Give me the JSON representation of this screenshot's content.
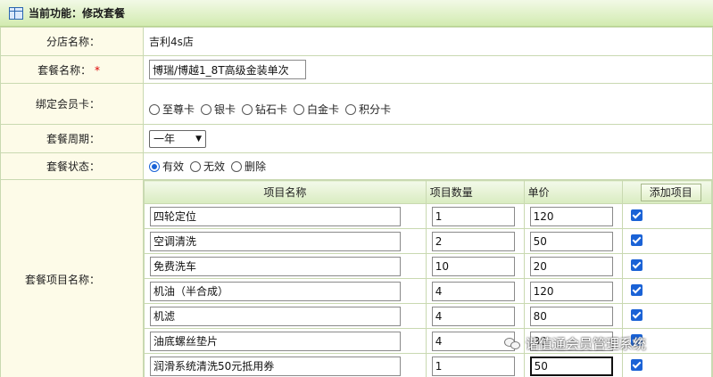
{
  "header": {
    "title": "当前功能：修改套餐",
    "icon": "table-icon"
  },
  "store": {
    "label": "分店名称：",
    "value": "吉利4s店"
  },
  "package_name": {
    "label": "套餐名称：",
    "required": "*",
    "value": "博瑞/博越1_8T高级金装单次"
  },
  "member_card": {
    "label": "绑定会员卡：",
    "options": [
      "至尊卡",
      "银卡",
      "钻石卡",
      "白金卡",
      "积分卡"
    ]
  },
  "period": {
    "label": "套餐周期：",
    "value": "一年"
  },
  "status": {
    "label": "套餐状态：",
    "options": [
      "有效",
      "无效",
      "删除"
    ],
    "selected": "有效"
  },
  "items": {
    "label": "套餐项目名称：",
    "headers": [
      "项目名称",
      "项目数量",
      "单价"
    ],
    "add_button": "添加项目",
    "rows": [
      {
        "name": "四轮定位",
        "qty": "1",
        "price": "120"
      },
      {
        "name": "空调清洗",
        "qty": "2",
        "price": "50"
      },
      {
        "name": "免费洗车",
        "qty": "10",
        "price": "20"
      },
      {
        "name": "机油（半合成）",
        "qty": "4",
        "price": "120"
      },
      {
        "name": "机滤",
        "qty": "4",
        "price": "80"
      },
      {
        "name": "油底螺丝垫片",
        "qty": "4",
        "price": "30"
      },
      {
        "name": "润滑系统清洗50元抵用券",
        "qty": "1",
        "price": "50"
      }
    ]
  },
  "watermark": {
    "text": "谐值通会员管理系统"
  },
  "colors": {
    "header_bg": "#d2ebb0",
    "label_bg": "#fdfbe8",
    "border": "#c9d9b1",
    "accent": "#1a62d6"
  }
}
